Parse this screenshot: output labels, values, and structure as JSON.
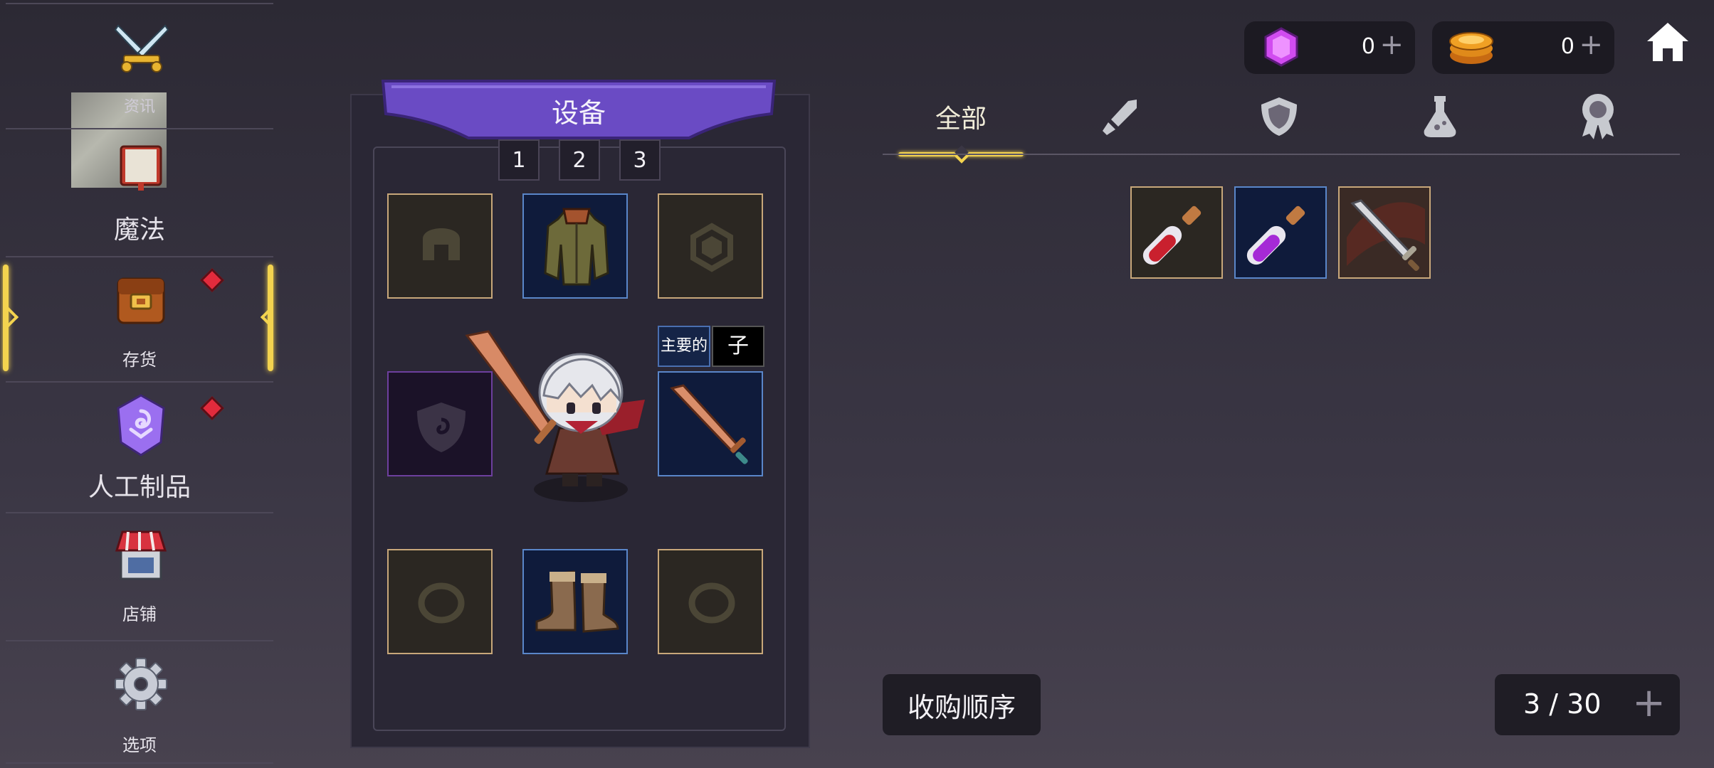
{
  "sidebar": {
    "items": [
      {
        "label": "资讯",
        "icon": "crossed-swords-icon"
      },
      {
        "label": "魔法",
        "icon": "spellbook-icon"
      },
      {
        "label": "存货",
        "icon": "backpack-icon",
        "selected": true,
        "badge": true
      },
      {
        "label": "人工制品",
        "icon": "rune-stone-icon",
        "badge": true
      },
      {
        "label": "店铺",
        "icon": "shop-icon"
      },
      {
        "label": "选项",
        "icon": "gear-icon"
      }
    ]
  },
  "equipment": {
    "title": "设备",
    "loadouts": [
      "1",
      "2",
      "3"
    ],
    "weapon_tabs": {
      "main": "主要的",
      "sub": "子"
    }
  },
  "currency": {
    "gems": {
      "value": "0",
      "plus": "+"
    },
    "coins": {
      "value": "0",
      "plus": "+"
    }
  },
  "filters": {
    "all_label": "全部",
    "tabs": [
      "sword-icon",
      "shield-icon",
      "potion-icon",
      "medal-icon"
    ]
  },
  "inventory": {
    "items": [
      {
        "name": "red-potion",
        "rarity": "common"
      },
      {
        "name": "purple-potion",
        "rarity": "rare"
      },
      {
        "name": "iron-sword",
        "rarity": "common"
      }
    ],
    "capacity": "3 / 30",
    "capacity_plus": "+",
    "sort_label": "收购顺序"
  },
  "colors": {
    "accent_gold": "#f3d34f",
    "banner_purple": "#6a4bc4",
    "badge_red": "#e22b3c",
    "gem_pink": "#d14cf0",
    "coin_orange": "#f0a024"
  }
}
